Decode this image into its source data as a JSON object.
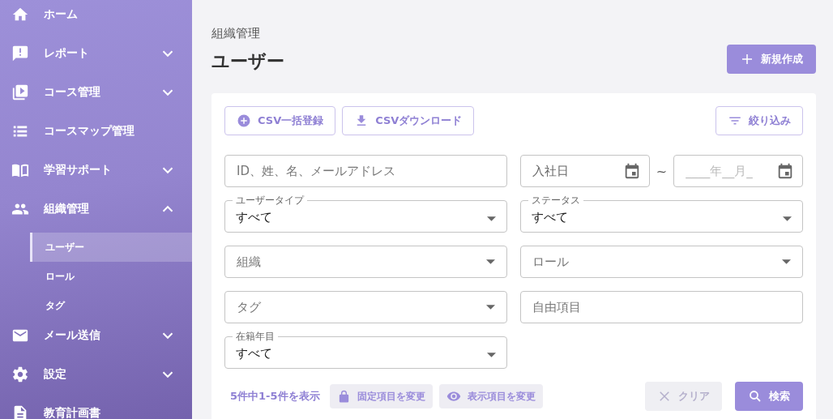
{
  "sidebar": {
    "items": [
      {
        "kind": "link",
        "label": "ホーム"
      },
      {
        "kind": "group",
        "label": "レポート",
        "expanded": false
      },
      {
        "kind": "group",
        "label": "コース管理",
        "expanded": false
      },
      {
        "kind": "link",
        "label": "コースマップ管理"
      },
      {
        "kind": "group",
        "label": "学習サポート",
        "expanded": false
      },
      {
        "kind": "group",
        "label": "組織管理",
        "expanded": true,
        "children": [
          {
            "label": "ユーザー",
            "selected": true
          },
          {
            "label": "ロール",
            "selected": false
          },
          {
            "label": "タグ",
            "selected": false
          }
        ]
      },
      {
        "kind": "group",
        "label": "メール送信",
        "expanded": false
      },
      {
        "kind": "group",
        "label": "設定",
        "expanded": false
      },
      {
        "kind": "link",
        "label": "教育計画書"
      }
    ]
  },
  "header": {
    "breadcrumb": "組織管理",
    "title": "ユーザー",
    "new_button": "新規作成"
  },
  "toolbar": {
    "left_buttons": [
      "CSV一括登録",
      "CSVダウンロード"
    ],
    "filter_button": "絞り込み"
  },
  "filters": [
    {
      "kind": "text",
      "placeholder": "ID、姓、名、メールアドレス"
    },
    {
      "kind": "date_range",
      "from": {
        "placeholder": "入社日"
      },
      "separator": "~",
      "to": {
        "placeholder": "____年__月_"
      }
    },
    {
      "kind": "select",
      "label": "ユーザータイプ",
      "value": "すべて"
    },
    {
      "kind": "select",
      "label": "ステータス",
      "value": "すべて"
    },
    {
      "kind": "select",
      "placeholder": "組織"
    },
    {
      "kind": "select",
      "placeholder": "ロール"
    },
    {
      "kind": "select",
      "placeholder": "タグ"
    },
    {
      "kind": "text",
      "placeholder": "自由項目"
    },
    {
      "kind": "select",
      "label": "在籍年目",
      "value": "すべて"
    }
  ],
  "footer": {
    "result_count": "5件中1-5件を表示",
    "column_buttons": [
      "固定項目を変更",
      "表示項目を変更"
    ],
    "clear_button": {
      "label": "クリア",
      "disabled": true
    },
    "search_button": "検索"
  }
}
